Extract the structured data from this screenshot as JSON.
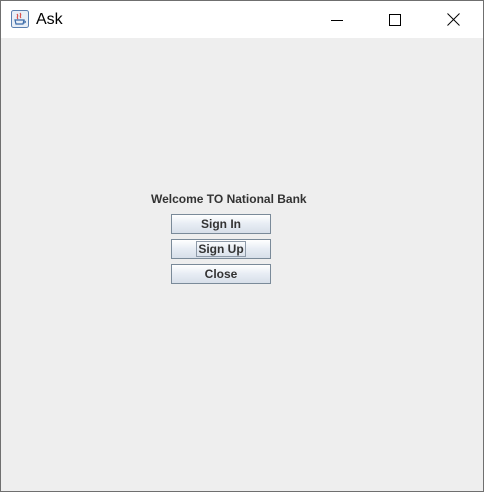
{
  "window": {
    "title": "Ask",
    "app_icon": "java-icon",
    "controls": {
      "minimize_icon": "minimize-icon",
      "maximize_icon": "maximize-icon",
      "close_icon": "close-icon"
    }
  },
  "panel": {
    "welcome_text": "Welcome TO National Bank",
    "buttons": {
      "sign_in": "Sign In",
      "sign_up": "Sign Up",
      "close": "Close"
    },
    "focused_button": "sign_up"
  },
  "colors": {
    "background": "#eeeeee",
    "titlebar": "#ffffff",
    "button_border": "#7a8a99",
    "text": "#333333"
  }
}
